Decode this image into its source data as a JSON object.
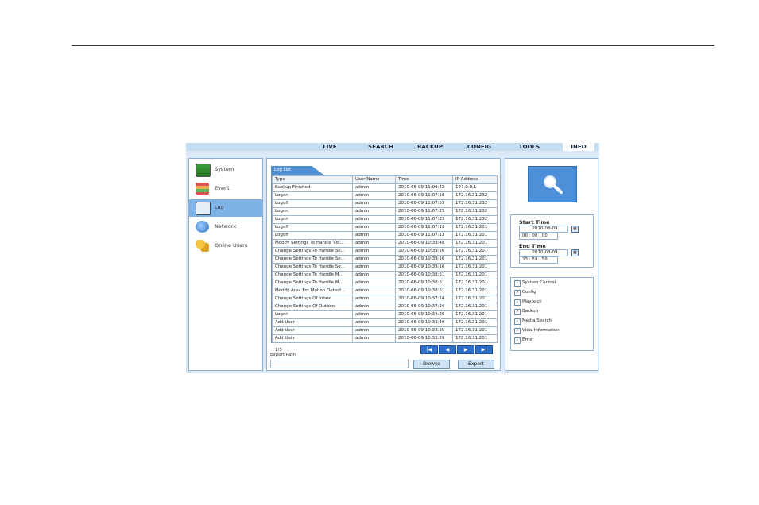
{
  "topnav": [
    "LIVE",
    "SEARCH",
    "BACKUP",
    "CONFIG",
    "TOOLS",
    "INFO"
  ],
  "sidebar": [
    "System",
    "Event",
    "Log",
    "Network",
    "Online Users"
  ],
  "log": {
    "tab": "Log List",
    "columns": [
      "Type",
      "User Name",
      "Time",
      "IP Address"
    ],
    "rows": [
      [
        "Backup Finished",
        "admin",
        "2010-08-09 11:09:42",
        "127.0.0.1"
      ],
      [
        "Logon",
        "admin",
        "2010-08-09 11:07:58",
        "172.16.31.232"
      ],
      [
        "Logoff",
        "admin",
        "2010-08-09 11:07:53",
        "172.16.31.232"
      ],
      [
        "Logon",
        "admin",
        "2010-08-09 11:07:25",
        "172.16.31.232"
      ],
      [
        "Logon",
        "admin",
        "2010-08-09 11:07:23",
        "172.16.31.232"
      ],
      [
        "Logoff",
        "admin",
        "2010-08-09 11:07:13",
        "172.16.31.201"
      ],
      [
        "Logoff",
        "admin",
        "2010-08-09 11:07:13",
        "172.16.31.201"
      ],
      [
        "Modify Settings To Handle Vid...",
        "admin",
        "2010-08-09 10:39:48",
        "172.16.31.201"
      ],
      [
        "Change Settings To Handle Se...",
        "admin",
        "2010-08-09 10:39:16",
        "172.16.31.201"
      ],
      [
        "Change Settings To Handle Se...",
        "admin",
        "2010-08-09 10:39:16",
        "172.16.31.201"
      ],
      [
        "Change Settings To Handle Se...",
        "admin",
        "2010-08-09 10:39:16",
        "172.16.31.201"
      ],
      [
        "Change Settings To Handle M...",
        "admin",
        "2010-08-09 10:38:51",
        "172.16.31.201"
      ],
      [
        "Change Settings To Handle M...",
        "admin",
        "2010-08-09 10:38:51",
        "172.16.31.201"
      ],
      [
        "Modify Area For Motion Detect...",
        "admin",
        "2010-08-09 10:38:51",
        "172.16.31.201"
      ],
      [
        "Change Settings Of Inbox",
        "admin",
        "2010-08-09 10:37:24",
        "172.16.31.201"
      ],
      [
        "Change Settings Of Outbox",
        "admin",
        "2010-08-09 10:37:24",
        "172.16.31.201"
      ],
      [
        "Logon",
        "admin",
        "2010-08-09 10:34:26",
        "172.16.31.201"
      ],
      [
        "Add User",
        "admin",
        "2010-08-09 10:33:40",
        "172.16.31.201"
      ],
      [
        "Add User",
        "admin",
        "2010-08-09 10:33:35",
        "172.16.31.201"
      ],
      [
        "Add User",
        "admin",
        "2010-08-09 10:33:29",
        "172.16.31.201"
      ]
    ],
    "page": "1/5",
    "export_label": "Export Path",
    "browse": "Browse",
    "export": "Export",
    "nav": [
      "|◀",
      "◀",
      "▶",
      "▶|"
    ]
  },
  "time": {
    "start_title": "Start Time",
    "start_date": "2010-08-09",
    "start_time": "00  :  00  :  00",
    "end_title": "End Time",
    "end_date": "2010-08-09",
    "end_time": "23  :  59  :  59"
  },
  "filters": [
    "System Control",
    "Config",
    "Playback",
    "Backup",
    "Media Search",
    "View Information",
    "Error"
  ],
  "icons": {
    "search": "magnifier-icon",
    "calendar": "calendar-icon",
    "system": "monitor-icon",
    "event": "books-icon",
    "log": "log-icon",
    "network": "globe-icon",
    "online": "users-icon"
  },
  "colors": {
    "accent": "#4d8fd8",
    "active_side": "#7eb3e8",
    "topbar": "#c4ddf3"
  }
}
